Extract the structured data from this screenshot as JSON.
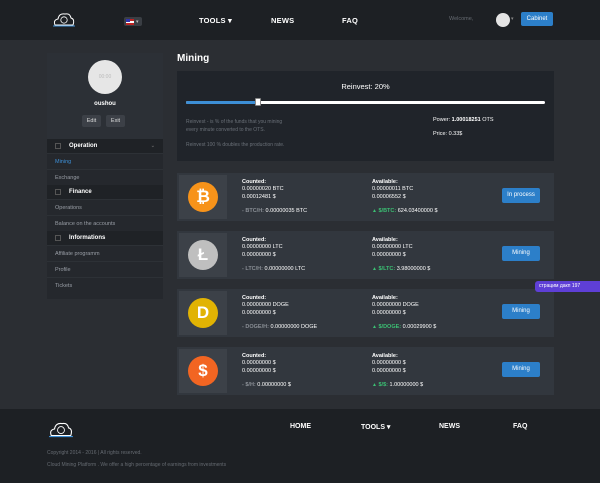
{
  "header": {
    "language_code": "▾",
    "nav": [
      {
        "label": "TOOLS ▾"
      },
      {
        "label": "NEWS"
      },
      {
        "label": "FAQ"
      }
    ],
    "welcome": "Welcome,",
    "user_caret": "▾",
    "cabinet_label": "Cabinet"
  },
  "sidebar": {
    "avatar_placeholder": "00:00",
    "username": "oushou",
    "edit_label": "Edit",
    "exit_label": "Exit",
    "sections": [
      {
        "title": "Operation",
        "items": [
          "Mining",
          "Exchange"
        ]
      },
      {
        "title": "Finance",
        "items": [
          "Operations",
          "Balance on the accounts"
        ]
      },
      {
        "title": "Informations",
        "items": [
          "Affiliate programm",
          "Profile",
          "Tickets"
        ]
      }
    ]
  },
  "main": {
    "title": "Mining",
    "reinvest": {
      "label": "Reinvest: 20%",
      "percent": 20,
      "note1_line1": "Reinvest - is % of the funds that you mining",
      "note1_line2": "every minute converted to the OTS.",
      "note2": "Reinvest 100 % doubles the production rate.",
      "power_label": "Power:",
      "power_value": "1.00018251",
      "power_unit": "OTS",
      "price": "Price: 0.33$"
    },
    "counted_label": "Counted:",
    "available_label": "Available:",
    "coins": [
      {
        "icon": "bitcoin-icon",
        "symbol": "₿",
        "color": "#f7931a",
        "counted_1": "0.00000020 BTC",
        "counted_2": "0.00012481 $",
        "available_1": "0.00000011 BTC",
        "available_2": "0.00006552 $",
        "rate_label": "BTC/H:",
        "rate_value": "0.00000035 BTC",
        "price_label": "$/BTC:",
        "price_value": "624.03400000 $",
        "button": "In process"
      },
      {
        "icon": "litecoin-icon",
        "symbol": "Ł",
        "color": "#bfbfbf",
        "counted_1": "0.00000000 LTC",
        "counted_2": "0.00000000 $",
        "available_1": "0.00000000 LTC",
        "available_2": "0.00000000 $",
        "rate_label": "LTC/H:",
        "rate_value": "0.00000000 LTC",
        "price_label": "$/LTC:",
        "price_value": "3.98000000 $",
        "button": "Mining"
      },
      {
        "icon": "dogecoin-icon",
        "symbol": "D",
        "color": "#e1b303",
        "counted_1": "0.00000000 DOGE",
        "counted_2": "0.00000000 $",
        "available_1": "0.00000000 DOGE",
        "available_2": "0.00000000 $",
        "rate_label": "DOGE/H:",
        "rate_value": "0.00000000 DOGE",
        "price_label": "$/DOGE:",
        "price_value": "0.00029900 $",
        "button": "Mining"
      },
      {
        "icon": "dollar-icon",
        "symbol": "$",
        "color": "#f26522",
        "counted_1": "0.00000000 $",
        "counted_2": "0.00000000 $",
        "available_1": "0.00000000 $",
        "available_2": "0.00000000 $",
        "rate_label": "$/H:",
        "rate_value": "0.00000000 $",
        "price_label": "$/$:",
        "price_value": "1.00000000 $",
        "button": "Mining"
      }
    ]
  },
  "side_badge": "страцим дакп   197",
  "footer": {
    "nav": [
      {
        "label": "HOME"
      },
      {
        "label": "TOOLS ▾"
      },
      {
        "label": "NEWS"
      },
      {
        "label": "FAQ"
      }
    ],
    "copyright": "Copyright 2014 - 2016           | All rights reserved.",
    "tagline": "Cloud Mining Platform . We offer a high percentage of earnings from investments"
  },
  "colors": {
    "accent": "#2c7fc9",
    "positive": "#3bbf73",
    "header_bg": "#1d2024"
  }
}
